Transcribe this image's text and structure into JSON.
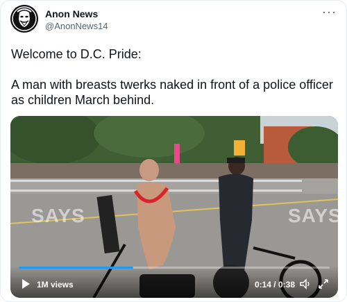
{
  "author": {
    "display_name": "Anon News",
    "handle": "@AnonNews14",
    "avatar_icon": "anonymous-mask-avatar"
  },
  "menu": {
    "icon": "more-options-icon",
    "label": "···"
  },
  "tweet": {
    "text": "Welcome to D.C. Pride:\n\nA man with breasts twerks naked in front of a police officer as children March behind."
  },
  "video": {
    "watermarks": [
      "SAYS",
      "SAYS"
    ],
    "views": "1M views",
    "time": "0:14 / 0:38",
    "progress": 0.3684,
    "accent_color": "#1d9bf0",
    "icons": [
      "play-icon",
      "volume-icon",
      "fullscreen-icon"
    ]
  }
}
